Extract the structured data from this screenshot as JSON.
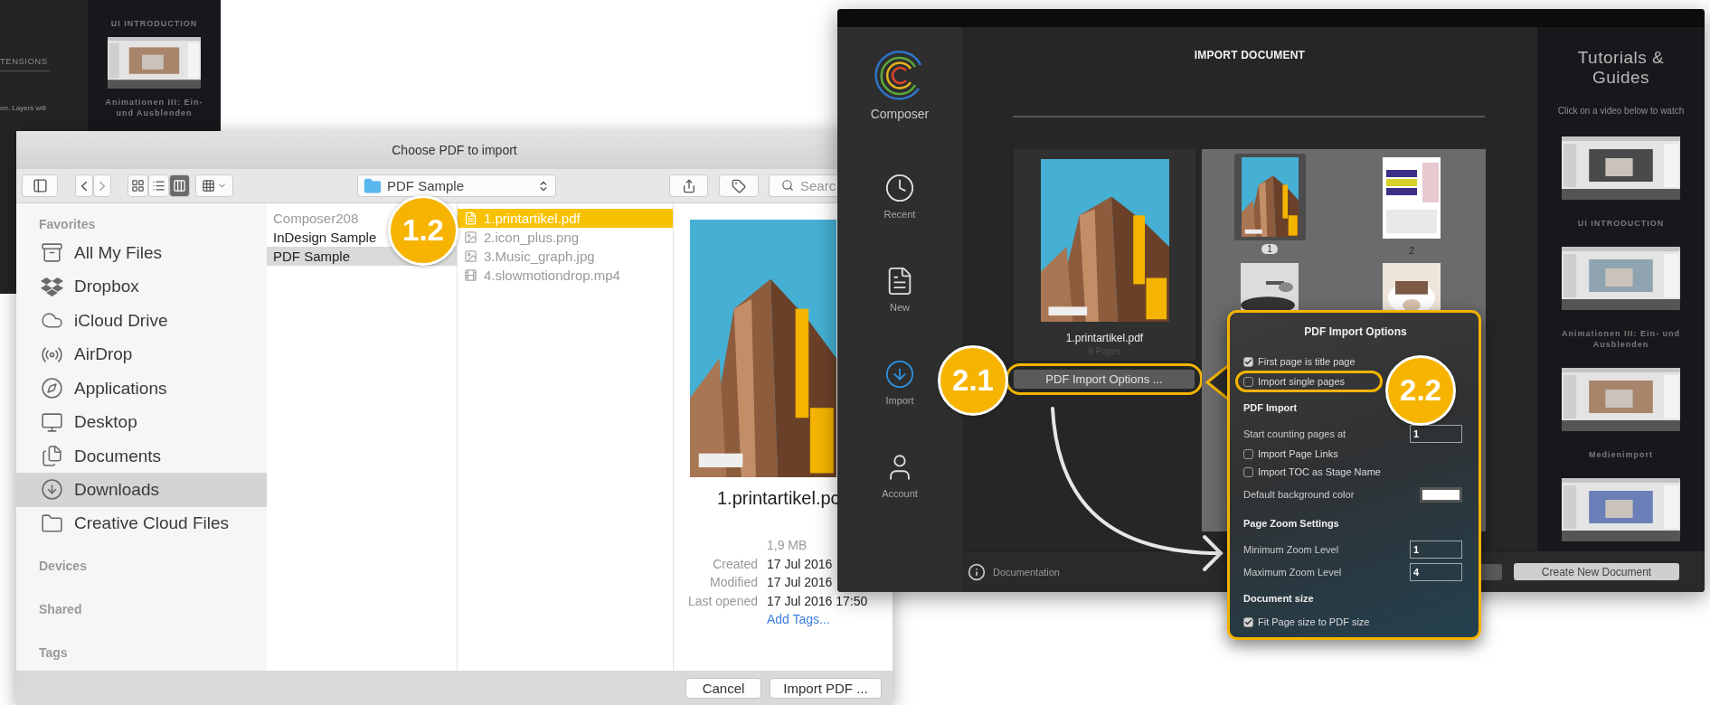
{
  "background_window": {
    "section": "TENSIONS",
    "text": "on. Layers will",
    "tutorials": [
      {
        "kind": "label",
        "text": "UI INTRODUCTION"
      },
      {
        "kind": "picture"
      },
      {
        "kind": "label",
        "text": "Animationen III: Ein- und Ausblenden"
      }
    ]
  },
  "finder": {
    "title": "Choose PDF to import",
    "views": [
      {
        "selected": false
      },
      {
        "selected": false
      },
      {
        "selected": true
      }
    ],
    "path": "PDF Sample",
    "search": {
      "placeholder": "Searc"
    },
    "sidebar": [
      {
        "heading": "Favorites",
        "items": [
          {
            "label": "All My Files",
            "selected": false
          },
          {
            "label": "Dropbox",
            "selected": false
          },
          {
            "label": "iCloud Drive",
            "selected": false
          },
          {
            "label": "AirDrop",
            "selected": false
          },
          {
            "label": "Applications",
            "selected": false
          },
          {
            "label": "Desktop",
            "selected": false
          },
          {
            "label": "Documents",
            "selected": false
          },
          {
            "label": "Downloads",
            "selected": true
          },
          {
            "label": "Creative Cloud Files",
            "selected": false
          }
        ]
      },
      {
        "heading": "Devices"
      },
      {
        "heading": "Shared"
      },
      {
        "heading": "Tags"
      }
    ],
    "columns": [
      [
        {
          "label": "Composer208",
          "selected": false,
          "disabled": true
        },
        {
          "label": "InDesign Sample",
          "selected": false,
          "disabled": false
        },
        {
          "label": "PDF Sample",
          "selected": true,
          "disabled": false
        }
      ],
      [
        {
          "label": "1.printartikel.pdf",
          "selected": true,
          "disabled": false
        },
        {
          "label": "2.icon_plus.png",
          "selected": false,
          "disabled": true
        },
        {
          "label": "3.Music_graph.jpg",
          "selected": false,
          "disabled": true
        },
        {
          "label": "4.slowmotiondrop.mp4",
          "selected": false,
          "disabled": true
        }
      ]
    ],
    "preview": {
      "name": "1.printartikel.pc",
      "size": "1,9 MB",
      "meta": [
        {
          "label": "Created",
          "value": "17 Jul 2016"
        },
        {
          "label": "Modified",
          "value": "17 Jul 2016"
        },
        {
          "label": "Last opened",
          "value": "17 Jul 2016 17:50"
        }
      ],
      "link": "Add Tags..."
    },
    "buttons": [
      "Cancel",
      "Import PDF ..."
    ]
  },
  "composer": {
    "app_name": "Composer",
    "nav": [
      {
        "label": "Recent",
        "selected": false
      },
      {
        "label": "New",
        "selected": false
      },
      {
        "label": "Import",
        "selected": true
      },
      {
        "label": "Account",
        "selected": false
      }
    ],
    "heading": "IMPORT DOCUMENT",
    "document": {
      "name": "1.printartikel.pdf",
      "pages": "9 Pages"
    },
    "options_button": "PDF Import Options ...",
    "pages": [
      {
        "label": "1",
        "selected": true
      },
      {
        "label": "2",
        "selected": false
      },
      {
        "selected": false
      },
      {
        "selected": false
      }
    ],
    "tutorials": {
      "title": "Tutorials & Guides",
      "subtitle": "Click on a video below to watch",
      "items": [
        {
          "kind": "picture"
        },
        {
          "kind": "label",
          "text": "UI INTRODUCTION"
        },
        {
          "kind": "picture"
        },
        {
          "kind": "label",
          "text": "Animationen III: Ein- und Ausblenden"
        },
        {
          "kind": "picture"
        },
        {
          "kind": "label",
          "text": "Medienimport"
        },
        {
          "kind": "picture"
        }
      ]
    },
    "footer": {
      "link": "Documentation",
      "button": "Create New Document"
    }
  },
  "popover": {
    "title": "PDF Import Options",
    "rows": [
      {
        "kind": "checkbox",
        "label": "First page is title page",
        "checked": true,
        "highlighted": false
      },
      {
        "kind": "checkbox",
        "label": "Import single pages",
        "checked": false,
        "highlighted": true
      },
      {
        "kind": "heading",
        "label": "PDF Import"
      },
      {
        "kind": "field",
        "label": "Start counting pages at",
        "value": "1"
      },
      {
        "kind": "checkbox",
        "label": "Import Page Links",
        "checked": false,
        "highlighted": false
      },
      {
        "kind": "checkbox",
        "label": "Import TOC as Stage Name",
        "checked": false,
        "highlighted": false
      },
      {
        "kind": "color",
        "label": "Default background color"
      },
      {
        "kind": "heading",
        "label": "Page Zoom Settings"
      },
      {
        "kind": "field",
        "label": "Minimum Zoom Level",
        "value": "1"
      },
      {
        "kind": "field",
        "label": "Maximum Zoom Level",
        "value": "4"
      },
      {
        "kind": "heading",
        "label": "Document size"
      },
      {
        "kind": "checkbox",
        "label": "Fit Page size to PDF size",
        "checked": true,
        "highlighted": false
      }
    ]
  },
  "callouts": [
    {
      "label": "1.2"
    },
    {
      "label": "2.1"
    },
    {
      "label": "2.2"
    }
  ]
}
